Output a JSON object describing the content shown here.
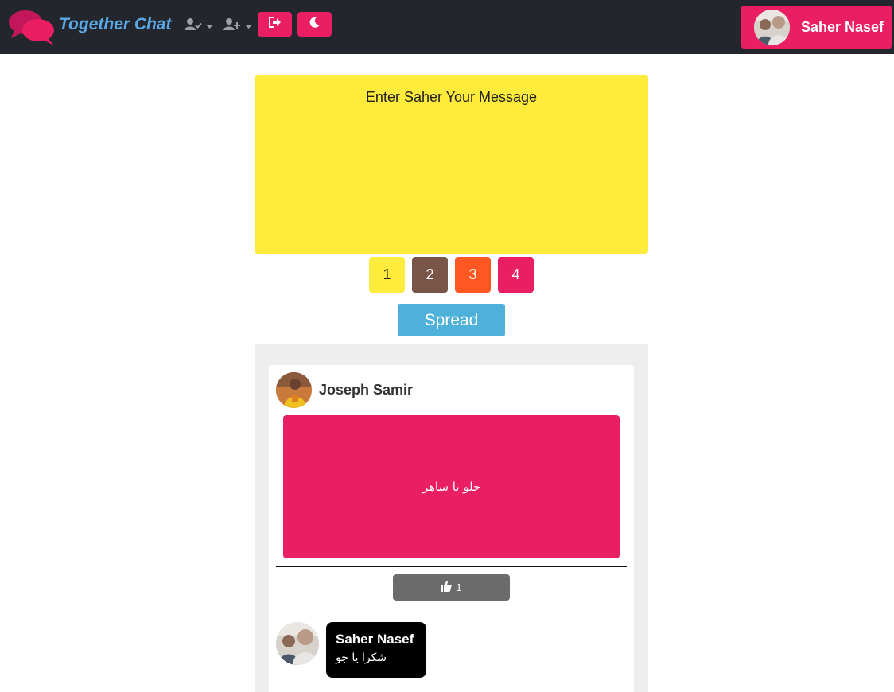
{
  "app": {
    "title": "Together Chat"
  },
  "navbar": {
    "dropdowns": [
      {
        "icon": "user-check-icon"
      },
      {
        "icon": "user-plus-icon"
      }
    ],
    "buttons": [
      {
        "icon": "sign-out-icon"
      },
      {
        "icon": "moon-icon"
      }
    ],
    "user": {
      "name": "Saher Nasef"
    }
  },
  "composer": {
    "placeholder": "Enter Saher Your Message",
    "colors": [
      {
        "label": "1",
        "color": "#ffeb3b",
        "text_color": "#212121"
      },
      {
        "label": "2",
        "color": "#795548",
        "text_color": "#ffffff"
      },
      {
        "label": "3",
        "color": "#ff5722",
        "text_color": "#ffffff"
      },
      {
        "label": "4",
        "color": "#e91e63",
        "text_color": "#ffffff"
      }
    ],
    "submit_label": "Spread"
  },
  "feed": {
    "posts": [
      {
        "author": "Joseph Samir",
        "text": "حلو يا ساهر",
        "color": "#e91e63",
        "likes": "1",
        "comments": [
          {
            "author": "Saher Nasef",
            "text": "شكرا يا جو"
          }
        ]
      }
    ]
  },
  "colors": {
    "accent": "#e91e63",
    "navbar_bg": "#23262c",
    "brand_text": "#5aa9e6",
    "spread": "#4db1d9"
  }
}
